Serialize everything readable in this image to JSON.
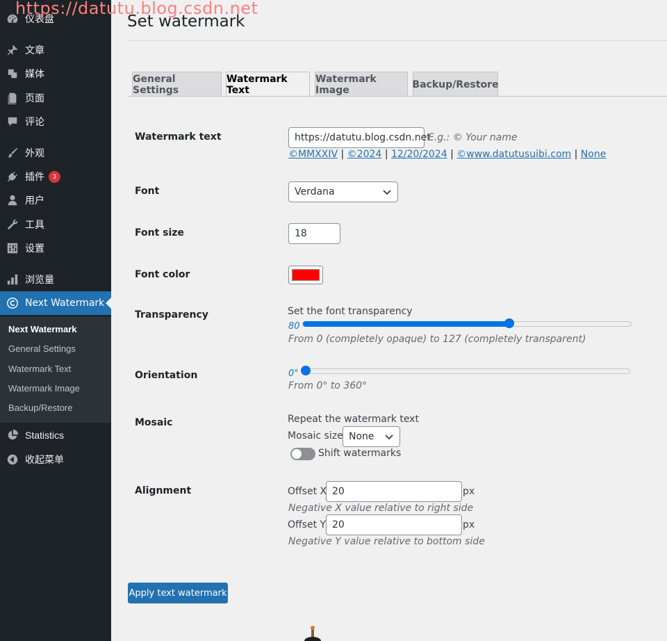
{
  "overlay_text": "https://datutu.blog.csdn.net",
  "sidebar": {
    "items": [
      {
        "label": "仪表盘",
        "icon": "dashboard-icon"
      },
      {
        "label": "文章",
        "icon": "pin-icon"
      },
      {
        "label": "媒体",
        "icon": "media-icon"
      },
      {
        "label": "页面",
        "icon": "page-icon"
      },
      {
        "label": "评论",
        "icon": "comment-icon"
      },
      {
        "label": "外观",
        "icon": "brush-icon"
      },
      {
        "label": "插件",
        "icon": "plugin-icon",
        "badge": "3"
      },
      {
        "label": "用户",
        "icon": "user-icon"
      },
      {
        "label": "工具",
        "icon": "wrench-icon"
      },
      {
        "label": "设置",
        "icon": "settings-icon"
      },
      {
        "label": "浏览量",
        "icon": "bar-chart-icon"
      },
      {
        "label": "Next Watermark",
        "icon": "copyright-icon"
      },
      {
        "label": "Statistics",
        "icon": "pie-chart-icon"
      },
      {
        "label": "收起菜单",
        "icon": "collapse-icon"
      }
    ],
    "submenu": [
      "Next Watermark",
      "General Settings",
      "Watermark Text",
      "Watermark Image",
      "Backup/Restore"
    ]
  },
  "page": {
    "title": "Set watermark",
    "tabs": [
      "General Settings",
      "Watermark Text",
      "Watermark Image",
      "Backup/Restore"
    ],
    "active_tab": "Watermark Text"
  },
  "form": {
    "watermark_text": {
      "label": "Watermark text",
      "value": "https://datutu.blog.csdn.net",
      "hint": "E.g.: © Your name",
      "presets": [
        "©MMXXIV",
        "©2024",
        "12/20/2024",
        "©www.datutusuibi.com",
        "None"
      ],
      "separator": " | "
    },
    "font": {
      "label": "Font",
      "value": "Verdana"
    },
    "font_size": {
      "label": "Font size",
      "value": "18"
    },
    "font_color": {
      "label": "Font color",
      "value": "#ff0000"
    },
    "transparency": {
      "label": "Transparency",
      "desc": "Set the font transparency",
      "value": "80",
      "min": 0,
      "max": 127,
      "hint": "From 0 (completely opaque) to 127 (completely transparent)"
    },
    "orientation": {
      "label": "Orientation",
      "value": "0°",
      "degrees": 0,
      "max": 360,
      "hint": "From 0° to 360°"
    },
    "mosaic": {
      "label": "Mosaic",
      "desc": "Repeat the watermark text",
      "size_label": "Mosaic size",
      "size_value": "None",
      "shift_label": "Shift watermarks"
    },
    "alignment": {
      "label": "Alignment",
      "offset_x_label": "Offset X",
      "offset_x_value": "20",
      "offset_x_hint": "Negative X value relative to right side",
      "offset_y_label": "Offset Y",
      "offset_y_value": "20",
      "offset_y_hint": "Negative Y value relative to bottom side",
      "unit": "px"
    },
    "apply_label": "Apply text watermark"
  },
  "colors": {
    "accent": "#2271b1",
    "sidebar_bg": "#1d2327",
    "slider": "#0073e6"
  }
}
